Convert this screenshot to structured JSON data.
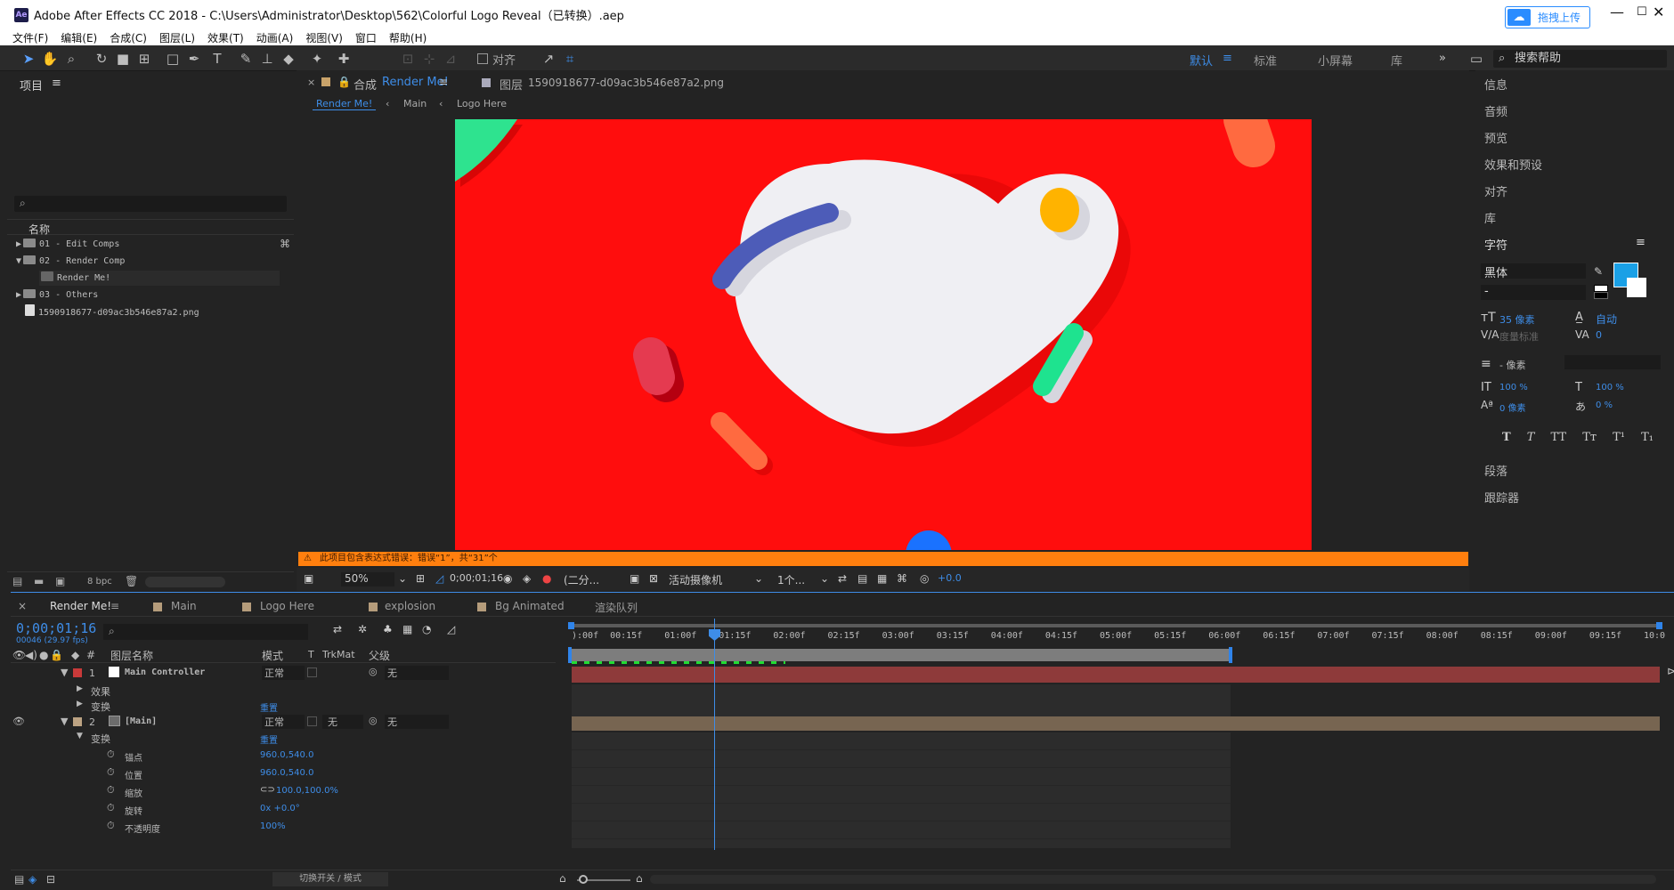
{
  "window": {
    "title": "Adobe After Effects CC 2018 - C:\\Users\\Administrator\\Desktop\\562\\Colorful Logo Reveal（已转换）.aep",
    "app_icon": "Ae",
    "upload_label": "拖拽上传",
    "minimize": "—",
    "maximize": "☐",
    "close": "✕"
  },
  "menu": [
    "文件(F)",
    "编辑(E)",
    "合成(C)",
    "图层(L)",
    "效果(T)",
    "动画(A)",
    "视图(V)",
    "窗口",
    "帮助(H)"
  ],
  "toolbar": {
    "snap_label": "对齐",
    "workspaces": [
      "默认",
      "标准",
      "小屏幕",
      "库"
    ],
    "search_help": "搜索帮助"
  },
  "project": {
    "title": "项目",
    "search_placeholder": "",
    "name_header": "名称",
    "items": [
      {
        "label": "01 - Edit Comps",
        "type": "folder",
        "expanded": false
      },
      {
        "label": "02 - Render Comp",
        "type": "folder",
        "expanded": true
      },
      {
        "label": "Render Me!",
        "type": "comp",
        "expanded": false
      },
      {
        "label": "03 - Others",
        "type": "folder",
        "expanded": false
      },
      {
        "label": "1590918677-d09ac3b546e87a2.png",
        "type": "image",
        "expanded": false
      }
    ],
    "bpc": "8 bpc"
  },
  "viewer": {
    "tab_comp_prefix": "合成",
    "tab_comp_name": "Render Me!",
    "tab_layer_prefix": "图层",
    "tab_layer_name": "1590918677-d09ac3b546e87a2.png",
    "breadcrumbs": [
      "Render Me!",
      "Main",
      "Logo Here"
    ],
    "warning": "此项目包含表达式错误：错误“1”，共“31”个",
    "zoom": "50%",
    "timecode": "0;00;01;16",
    "resolution": "(二分...",
    "camera": "活动摄像机",
    "views": "1个...",
    "exposure": "+0.0"
  },
  "right_panel": {
    "items_top": [
      "信息",
      "音频",
      "预览",
      "效果和预设",
      "对齐",
      "库"
    ],
    "char_title": "字符",
    "font_family": "黑体",
    "font_style": "-",
    "font_size": "35 像素",
    "leading": "自动",
    "kerning": "度量标准",
    "tracking": "0",
    "stroke_width": "- 像素",
    "vscale": "100 %",
    "hscale": "100 %",
    "baseline": "0 像素",
    "tsume": "0 %",
    "text_styles": [
      "T",
      "T",
      "TT",
      "Tт",
      "T¹",
      "T₁"
    ],
    "items_bottom": [
      "段落",
      "跟踪器"
    ],
    "fill_color": "#1aa0e6"
  },
  "timeline": {
    "tabs": [
      "Render Me!",
      "Main",
      "Logo Here",
      "explosion",
      "Bg Animated",
      "渲染队列"
    ],
    "timecode": "0;00;01;16",
    "fps": "00046 (29.97 fps)",
    "headers": {
      "num": "#",
      "name": "图层名称",
      "mode": "模式",
      "t": "T",
      "trkmat": "TrkMat",
      "parent": "父级"
    },
    "ruler": [
      "):00f",
      "00:15f",
      "01:00f",
      "01:15f",
      "02:00f",
      "02:15f",
      "03:00f",
      "03:15f",
      "04:00f",
      "04:15f",
      "05:00f",
      "05:15f",
      "06:00f",
      "06:15f",
      "07:00f",
      "07:15f",
      "08:00f",
      "08:15f",
      "09:00f",
      "09:15f",
      "10:0"
    ],
    "layers": [
      {
        "num": "1",
        "name": "Main Controller",
        "mode": "正常",
        "trkmat": "",
        "parent": "无",
        "color": "#c93a3a"
      },
      {
        "num": "2",
        "name": "[Main]",
        "mode": "正常",
        "trkmat": "无",
        "parent": "无",
        "color": "#bca383"
      }
    ],
    "sub_effects": "效果",
    "sub_transform": "变换",
    "reset": "重置",
    "props": [
      {
        "name": "锚点",
        "value": "960.0,540.0"
      },
      {
        "name": "位置",
        "value": "960.0,540.0"
      },
      {
        "name": "缩放",
        "value": "100.0,100.0%"
      },
      {
        "name": "旋转",
        "value": "0x +0.0°"
      },
      {
        "name": "不透明度",
        "value": "100%"
      }
    ],
    "toggle_label": "切换开关 / 模式"
  }
}
